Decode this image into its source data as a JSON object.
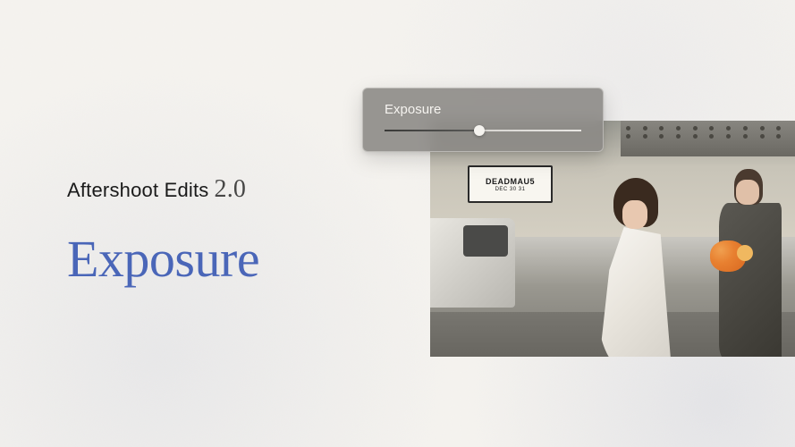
{
  "header": {
    "product_name": "Aftershoot Edits",
    "version": "2.0"
  },
  "feature": {
    "title": "Exposure"
  },
  "slider": {
    "label": "Exposure",
    "value_percent": 48
  },
  "photo": {
    "marquee_text": "DEADMAU5",
    "marquee_subtext": "DEC 30 31"
  },
  "colors": {
    "title_color": "#4a66b8",
    "background": "#f5f3ef"
  }
}
